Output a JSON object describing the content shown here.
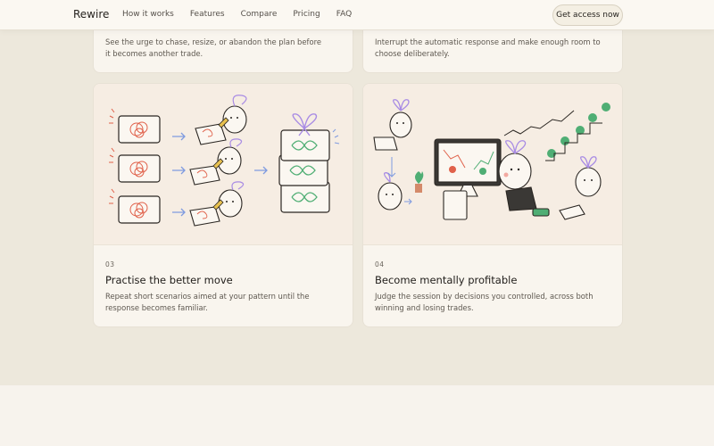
{
  "nav": {
    "brand": "Rewire",
    "links": [
      "How it works",
      "Features",
      "Compare",
      "Pricing",
      "FAQ"
    ],
    "cta": "Get access now"
  },
  "cards_top": [
    {
      "desc": "See the urge to chase, resize, or abandon the plan before it becomes another trade."
    },
    {
      "desc": "Interrupt the automatic response and make enough room to choose deliberately."
    }
  ],
  "cards": [
    {
      "number": "03",
      "title": "Practise the better move",
      "desc": "Repeat short scenarios aimed at your pattern until the response becomes familiar."
    },
    {
      "number": "04",
      "title": "Become mentally profitable",
      "desc": "Judge the session by decisions you controlled, across both winning and losing trades."
    }
  ],
  "colors": {
    "background": "#ede8dc",
    "card": "#f9f5ee",
    "scribble": "#e0614a",
    "arrow": "#7f9be0",
    "ribbon": "#a88be4",
    "check": "#4fae74"
  }
}
